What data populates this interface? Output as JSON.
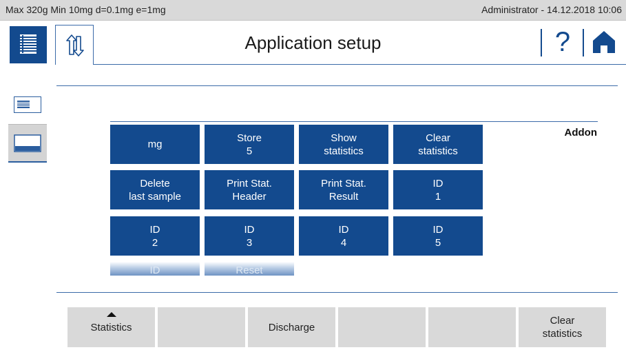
{
  "status_bar": {
    "scale_info": "Max 320g  Min 10mg  d=0.1mg  e=1mg",
    "user_datetime": "Administrator  -  14.12.2018 10:06"
  },
  "header": {
    "title": "Application setup",
    "help_glyph": "?",
    "icons": [
      "menu-list-icon",
      "up-down-arrows-icon",
      "help-icon",
      "home-icon"
    ]
  },
  "side_views": [
    "list-view-icon",
    "function-keys-view-icon"
  ],
  "section": {
    "label": "Addon"
  },
  "function_keys": [
    {
      "line1": "mg",
      "line2": ""
    },
    {
      "line1": "Store",
      "line2": "5"
    },
    {
      "line1": "Show",
      "line2": "statistics"
    },
    {
      "line1": "Clear",
      "line2": "statistics"
    },
    {
      "line1": "Delete",
      "line2": "last sample"
    },
    {
      "line1": "Print Stat.",
      "line2": "Header"
    },
    {
      "line1": "Print Stat.",
      "line2": "Result"
    },
    {
      "line1": "ID",
      "line2": "1"
    },
    {
      "line1": "ID",
      "line2": "2"
    },
    {
      "line1": "ID",
      "line2": "3"
    },
    {
      "line1": "ID",
      "line2": "4"
    },
    {
      "line1": "ID",
      "line2": "5"
    },
    {
      "line1": "ID",
      "line2": ""
    },
    {
      "line1": "Reset",
      "line2": ""
    }
  ],
  "softkeys": [
    {
      "line1": "Statistics",
      "line2": "",
      "has_arrow": true
    },
    {
      "line1": "",
      "line2": ""
    },
    {
      "line1": "Discharge",
      "line2": ""
    },
    {
      "line1": "",
      "line2": ""
    },
    {
      "line1": "",
      "line2": ""
    },
    {
      "line1": "Clear",
      "line2": "statistics"
    }
  ],
  "colors": {
    "primary": "#134a8e",
    "status_bar": "#d9d9d9",
    "softkey": "#d9d9d9",
    "rule": "#3a6aa8"
  }
}
